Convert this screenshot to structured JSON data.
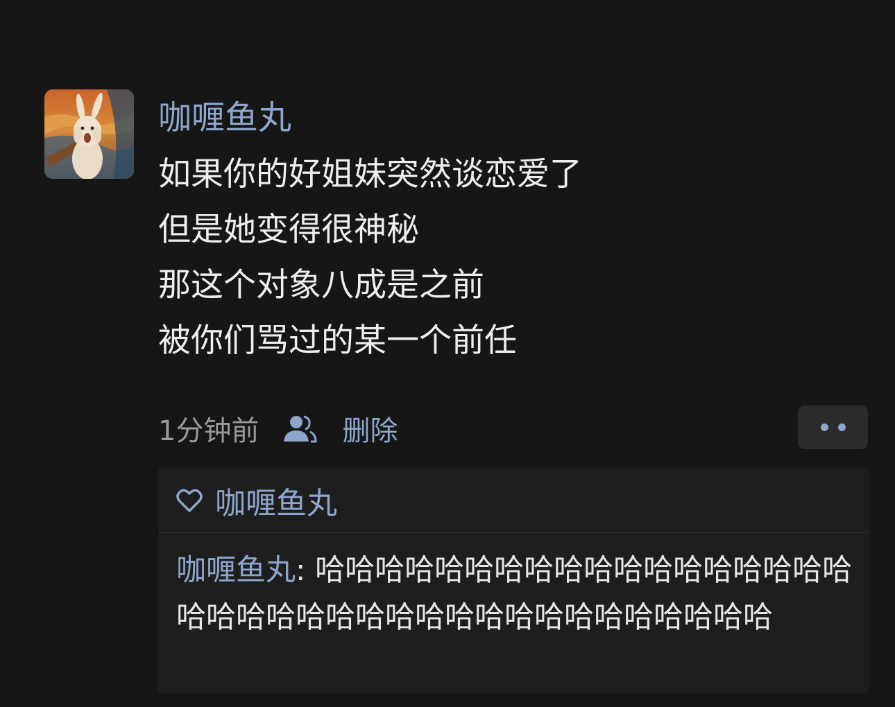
{
  "post": {
    "username": "咖喱鱼丸",
    "lines": [
      "如果你的好姐妹突然谈恋爱了",
      "但是她变得很神秘",
      "那这个对象八成是之前",
      "被你们骂过的某一个前任"
    ],
    "timestamp": "1分钟前",
    "visibility_icon": "friends-icon",
    "delete_label": "删除",
    "more_icon": "more-dots-icon"
  },
  "likes": {
    "icon": "heart-icon",
    "names": "咖喱鱼丸"
  },
  "comment": {
    "author": "咖喱鱼丸",
    "separator": ": ",
    "text": "哈哈哈哈哈哈哈哈哈哈哈哈哈哈哈哈哈哈哈哈哈哈哈哈哈哈哈哈哈哈哈哈哈哈哈哈哈哈"
  },
  "colors": {
    "background": "#161616",
    "name_blue": "#8fa6cc",
    "text": "#eeeeee",
    "muted": "#9a9a9a",
    "panel": "#1e1e1e"
  }
}
